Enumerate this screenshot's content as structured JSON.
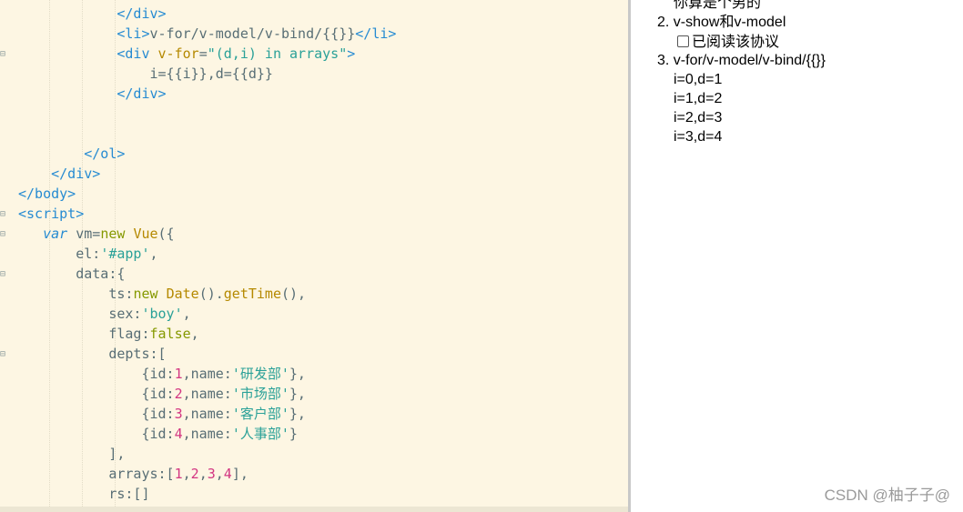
{
  "editor": {
    "lines": [
      [
        {
          "t": "            ",
          "c": "plain"
        },
        {
          "t": "</div>",
          "c": "tag"
        }
      ],
      [
        {
          "t": "            ",
          "c": "plain"
        },
        {
          "t": "<li>",
          "c": "tag"
        },
        {
          "t": "v-for/v-model/v-bind/{{}}",
          "c": "plain"
        },
        {
          "t": "</li>",
          "c": "tag"
        }
      ],
      [
        {
          "t": "            ",
          "c": "plain"
        },
        {
          "t": "<div ",
          "c": "tag"
        },
        {
          "t": "v-for",
          "c": "attr"
        },
        {
          "t": "=",
          "c": "plain"
        },
        {
          "t": "\"(d,i) in arrays\"",
          "c": "str"
        },
        {
          "t": ">",
          "c": "tag"
        }
      ],
      [
        {
          "t": "                i={{i}},d={{d}}",
          "c": "plain"
        }
      ],
      [
        {
          "t": "            ",
          "c": "plain"
        },
        {
          "t": "</div>",
          "c": "tag"
        }
      ],
      [
        {
          "t": "",
          "c": "plain"
        }
      ],
      [
        {
          "t": "",
          "c": "plain"
        }
      ],
      [
        {
          "t": "        ",
          "c": "plain"
        },
        {
          "t": "</ol>",
          "c": "tag"
        }
      ],
      [
        {
          "t": "    ",
          "c": "plain"
        },
        {
          "t": "</div>",
          "c": "tag"
        }
      ],
      [
        {
          "t": "</body>",
          "c": "tag"
        }
      ],
      [
        {
          "t": "<script>",
          "c": "tag"
        }
      ],
      [
        {
          "t": "   ",
          "c": "plain"
        },
        {
          "t": "var",
          "c": "var"
        },
        {
          "t": " vm=",
          "c": "plain"
        },
        {
          "t": "new",
          "c": "kw"
        },
        {
          "t": " ",
          "c": "plain"
        },
        {
          "t": "Vue",
          "c": "fn"
        },
        {
          "t": "({",
          "c": "plain"
        }
      ],
      [
        {
          "t": "       el:",
          "c": "plain"
        },
        {
          "t": "'#app'",
          "c": "str"
        },
        {
          "t": ",",
          "c": "plain"
        }
      ],
      [
        {
          "t": "       data:{",
          "c": "plain"
        }
      ],
      [
        {
          "t": "           ts:",
          "c": "plain"
        },
        {
          "t": "new",
          "c": "kw"
        },
        {
          "t": " ",
          "c": "plain"
        },
        {
          "t": "Date",
          "c": "fn"
        },
        {
          "t": "().",
          "c": "plain"
        },
        {
          "t": "getTime",
          "c": "fn"
        },
        {
          "t": "(),",
          "c": "plain"
        }
      ],
      [
        {
          "t": "           sex:",
          "c": "plain"
        },
        {
          "t": "'boy'",
          "c": "str"
        },
        {
          "t": ",",
          "c": "plain"
        }
      ],
      [
        {
          "t": "           flag:",
          "c": "plain"
        },
        {
          "t": "false",
          "c": "kw"
        },
        {
          "t": ",",
          "c": "plain"
        }
      ],
      [
        {
          "t": "           depts:[",
          "c": "plain"
        }
      ],
      [
        {
          "t": "               {id:",
          "c": "plain"
        },
        {
          "t": "1",
          "c": "num"
        },
        {
          "t": ",name:",
          "c": "plain"
        },
        {
          "t": "'研发部'",
          "c": "str"
        },
        {
          "t": "},",
          "c": "plain"
        }
      ],
      [
        {
          "t": "               {id:",
          "c": "plain"
        },
        {
          "t": "2",
          "c": "num"
        },
        {
          "t": ",name:",
          "c": "plain"
        },
        {
          "t": "'市场部'",
          "c": "str"
        },
        {
          "t": "},",
          "c": "plain"
        }
      ],
      [
        {
          "t": "               {id:",
          "c": "plain"
        },
        {
          "t": "3",
          "c": "num"
        },
        {
          "t": ",name:",
          "c": "plain"
        },
        {
          "t": "'客户部'",
          "c": "str"
        },
        {
          "t": "},",
          "c": "plain"
        }
      ],
      [
        {
          "t": "               {id:",
          "c": "plain"
        },
        {
          "t": "4",
          "c": "num"
        },
        {
          "t": ",name:",
          "c": "plain"
        },
        {
          "t": "'人事部'",
          "c": "str"
        },
        {
          "t": "}",
          "c": "plain"
        }
      ],
      [
        {
          "t": "           ],",
          "c": "plain"
        }
      ],
      [
        {
          "t": "           arrays:[",
          "c": "plain"
        },
        {
          "t": "1",
          "c": "num"
        },
        {
          "t": ",",
          "c": "plain"
        },
        {
          "t": "2",
          "c": "num"
        },
        {
          "t": ",",
          "c": "plain"
        },
        {
          "t": "3",
          "c": "num"
        },
        {
          "t": ",",
          "c": "plain"
        },
        {
          "t": "4",
          "c": "num"
        },
        {
          "t": "],",
          "c": "plain"
        }
      ],
      [
        {
          "t": "           rs:[]",
          "c": "plain"
        }
      ]
    ]
  },
  "preview": {
    "partial_line": "你算是个男的",
    "item2_number": "2.",
    "item2_text": "v-show和v-model",
    "checkbox_label": "已阅读该协议",
    "item3_number": "3.",
    "item3_text": "v-for/v-model/v-bind/{{}}",
    "loop_rows": [
      "i=0,d=1",
      "i=1,d=2",
      "i=2,d=3",
      "i=3,d=4"
    ]
  },
  "watermark": "CSDN @柚子子@"
}
